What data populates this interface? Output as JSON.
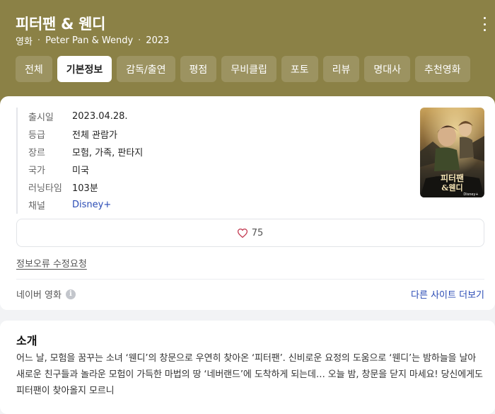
{
  "header": {
    "title": "피터팬 & 웬디",
    "meta": [
      "영화",
      "Peter Pan & Wendy",
      "2023"
    ],
    "more_icon": "kebab-menu-icon",
    "bg_color": "#8b8146"
  },
  "tabs": [
    {
      "label": "전체",
      "active": false
    },
    {
      "label": "기본정보",
      "active": true
    },
    {
      "label": "감독/출연",
      "active": false
    },
    {
      "label": "평점",
      "active": false
    },
    {
      "label": "무비클립",
      "active": false
    },
    {
      "label": "포토",
      "active": false
    },
    {
      "label": "리뷰",
      "active": false
    },
    {
      "label": "명대사",
      "active": false
    },
    {
      "label": "추천영화",
      "active": false
    }
  ],
  "info": {
    "release": {
      "label": "출시일",
      "value": "2023.04.28."
    },
    "rating": {
      "label": "등급",
      "value": "전체 관람가"
    },
    "genre": {
      "label": "장르",
      "value": "모험, 가족, 판타지"
    },
    "country": {
      "label": "국가",
      "value": "미국"
    },
    "runtime": {
      "label": "러닝타임",
      "value": "103분"
    },
    "channel": {
      "label": "채널",
      "value": "Disney+"
    }
  },
  "poster": {
    "title_line1": "피터팬",
    "title_line2": "&웬디",
    "brand": "Disney+"
  },
  "like": {
    "icon": "heart-icon",
    "count": "75"
  },
  "report_link": "정보오류 수정요청",
  "source": {
    "label": "네이버 영화",
    "icon": "info-icon"
  },
  "more_sites": "다른 사이트 더보기",
  "intro": {
    "title": "소개",
    "text": "어느 날, 모험을 꿈꾸는 소녀 ‘웬디’의 창문으로 우연히 찾아온 ‘피터팬’. 신비로운 요정의 도움으로 ‘웬디’는 밤하늘을 날아 새로운 친구들과 놀라운 모험이 가득한 마법의 땅 ‘네버랜드’에 도착하게 되는데… 오늘 밤, 창문을 닫지 마세요! 당신에게도 피터팬이 찾아올지 모르니"
  }
}
